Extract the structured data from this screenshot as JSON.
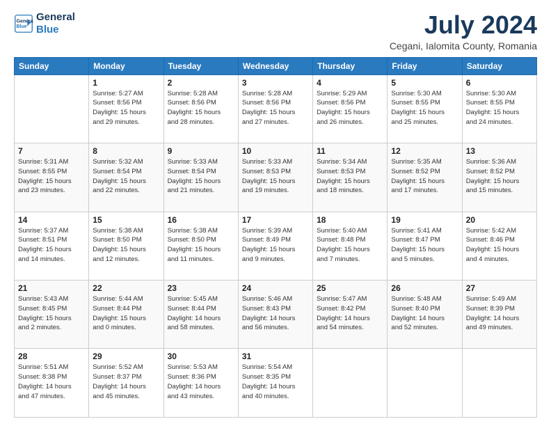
{
  "logo": {
    "line1": "General",
    "line2": "Blue"
  },
  "title": "July 2024",
  "subtitle": "Cegani, Ialomita County, Romania",
  "days_header": [
    "Sunday",
    "Monday",
    "Tuesday",
    "Wednesday",
    "Thursday",
    "Friday",
    "Saturday"
  ],
  "weeks": [
    [
      {
        "day": "",
        "info": ""
      },
      {
        "day": "1",
        "info": "Sunrise: 5:27 AM\nSunset: 8:56 PM\nDaylight: 15 hours\nand 29 minutes."
      },
      {
        "day": "2",
        "info": "Sunrise: 5:28 AM\nSunset: 8:56 PM\nDaylight: 15 hours\nand 28 minutes."
      },
      {
        "day": "3",
        "info": "Sunrise: 5:28 AM\nSunset: 8:56 PM\nDaylight: 15 hours\nand 27 minutes."
      },
      {
        "day": "4",
        "info": "Sunrise: 5:29 AM\nSunset: 8:56 PM\nDaylight: 15 hours\nand 26 minutes."
      },
      {
        "day": "5",
        "info": "Sunrise: 5:30 AM\nSunset: 8:55 PM\nDaylight: 15 hours\nand 25 minutes."
      },
      {
        "day": "6",
        "info": "Sunrise: 5:30 AM\nSunset: 8:55 PM\nDaylight: 15 hours\nand 24 minutes."
      }
    ],
    [
      {
        "day": "7",
        "info": "Sunrise: 5:31 AM\nSunset: 8:55 PM\nDaylight: 15 hours\nand 23 minutes."
      },
      {
        "day": "8",
        "info": "Sunrise: 5:32 AM\nSunset: 8:54 PM\nDaylight: 15 hours\nand 22 minutes."
      },
      {
        "day": "9",
        "info": "Sunrise: 5:33 AM\nSunset: 8:54 PM\nDaylight: 15 hours\nand 21 minutes."
      },
      {
        "day": "10",
        "info": "Sunrise: 5:33 AM\nSunset: 8:53 PM\nDaylight: 15 hours\nand 19 minutes."
      },
      {
        "day": "11",
        "info": "Sunrise: 5:34 AM\nSunset: 8:53 PM\nDaylight: 15 hours\nand 18 minutes."
      },
      {
        "day": "12",
        "info": "Sunrise: 5:35 AM\nSunset: 8:52 PM\nDaylight: 15 hours\nand 17 minutes."
      },
      {
        "day": "13",
        "info": "Sunrise: 5:36 AM\nSunset: 8:52 PM\nDaylight: 15 hours\nand 15 minutes."
      }
    ],
    [
      {
        "day": "14",
        "info": "Sunrise: 5:37 AM\nSunset: 8:51 PM\nDaylight: 15 hours\nand 14 minutes."
      },
      {
        "day": "15",
        "info": "Sunrise: 5:38 AM\nSunset: 8:50 PM\nDaylight: 15 hours\nand 12 minutes."
      },
      {
        "day": "16",
        "info": "Sunrise: 5:38 AM\nSunset: 8:50 PM\nDaylight: 15 hours\nand 11 minutes."
      },
      {
        "day": "17",
        "info": "Sunrise: 5:39 AM\nSunset: 8:49 PM\nDaylight: 15 hours\nand 9 minutes."
      },
      {
        "day": "18",
        "info": "Sunrise: 5:40 AM\nSunset: 8:48 PM\nDaylight: 15 hours\nand 7 minutes."
      },
      {
        "day": "19",
        "info": "Sunrise: 5:41 AM\nSunset: 8:47 PM\nDaylight: 15 hours\nand 5 minutes."
      },
      {
        "day": "20",
        "info": "Sunrise: 5:42 AM\nSunset: 8:46 PM\nDaylight: 15 hours\nand 4 minutes."
      }
    ],
    [
      {
        "day": "21",
        "info": "Sunrise: 5:43 AM\nSunset: 8:45 PM\nDaylight: 15 hours\nand 2 minutes."
      },
      {
        "day": "22",
        "info": "Sunrise: 5:44 AM\nSunset: 8:44 PM\nDaylight: 15 hours\nand 0 minutes."
      },
      {
        "day": "23",
        "info": "Sunrise: 5:45 AM\nSunset: 8:44 PM\nDaylight: 14 hours\nand 58 minutes."
      },
      {
        "day": "24",
        "info": "Sunrise: 5:46 AM\nSunset: 8:43 PM\nDaylight: 14 hours\nand 56 minutes."
      },
      {
        "day": "25",
        "info": "Sunrise: 5:47 AM\nSunset: 8:42 PM\nDaylight: 14 hours\nand 54 minutes."
      },
      {
        "day": "26",
        "info": "Sunrise: 5:48 AM\nSunset: 8:40 PM\nDaylight: 14 hours\nand 52 minutes."
      },
      {
        "day": "27",
        "info": "Sunrise: 5:49 AM\nSunset: 8:39 PM\nDaylight: 14 hours\nand 49 minutes."
      }
    ],
    [
      {
        "day": "28",
        "info": "Sunrise: 5:51 AM\nSunset: 8:38 PM\nDaylight: 14 hours\nand 47 minutes."
      },
      {
        "day": "29",
        "info": "Sunrise: 5:52 AM\nSunset: 8:37 PM\nDaylight: 14 hours\nand 45 minutes."
      },
      {
        "day": "30",
        "info": "Sunrise: 5:53 AM\nSunset: 8:36 PM\nDaylight: 14 hours\nand 43 minutes."
      },
      {
        "day": "31",
        "info": "Sunrise: 5:54 AM\nSunset: 8:35 PM\nDaylight: 14 hours\nand 40 minutes."
      },
      {
        "day": "",
        "info": ""
      },
      {
        "day": "",
        "info": ""
      },
      {
        "day": "",
        "info": ""
      }
    ]
  ]
}
